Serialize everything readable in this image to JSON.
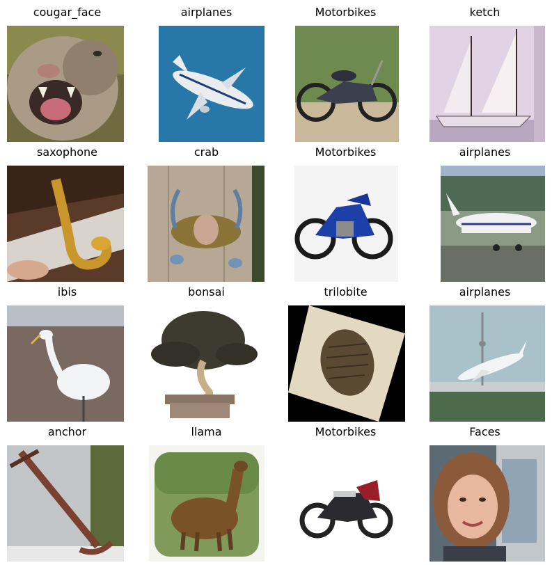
{
  "figure": {
    "titles": [
      "cougar_face",
      "airplanes",
      "Motorbikes",
      "ketch",
      "saxophone",
      "crab",
      "Motorbikes",
      "airplanes",
      "ibis",
      "bonsai",
      "trilobite",
      "airplanes",
      "anchor",
      "llama",
      "Motorbikes",
      "Faces"
    ]
  }
}
